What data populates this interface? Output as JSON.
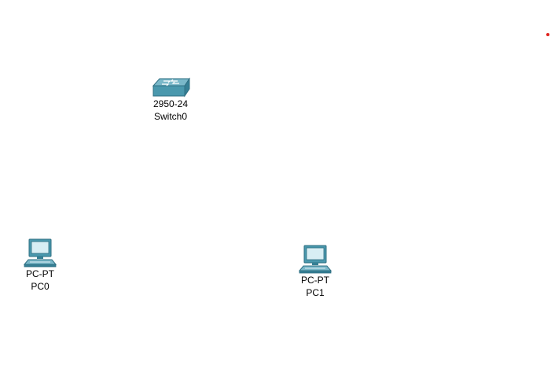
{
  "workspace": {
    "devices": [
      {
        "model": "2950-24",
        "name": "Switch0",
        "icon": "switch-icon"
      },
      {
        "model": "PC-PT",
        "name": "PC0",
        "icon": "pc-icon"
      },
      {
        "model": "PC-PT",
        "name": "PC1",
        "icon": "pc-icon"
      }
    ]
  },
  "colors": {
    "background": "#ffffff",
    "device_blue": "#4a98ad",
    "device_dark": "#2f6f82",
    "screen": "#d8eef4",
    "marker_red": "#e0201b"
  }
}
